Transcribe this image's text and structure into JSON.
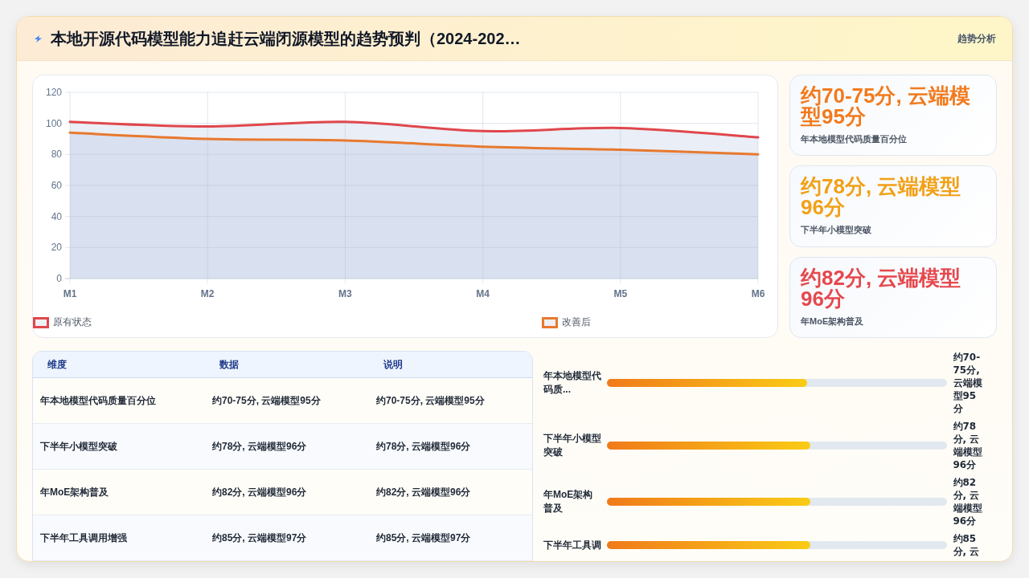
{
  "header": {
    "title": "本地开源代码模型能力追赶云端闭源模型的趋势预判（2024-202…",
    "tag": "趋势分析"
  },
  "chart": {
    "chart_data": {
      "type": "area",
      "categories": [
        "M1",
        "M2",
        "M3",
        "M4",
        "M5",
        "M6"
      ],
      "series": [
        {
          "name": "原有状态",
          "color": "#e0474c",
          "values": [
            101,
            98,
            101,
            95,
            97,
            91
          ]
        },
        {
          "name": "改善后",
          "color": "#e8792f",
          "values": [
            94,
            90,
            89,
            85,
            83,
            80
          ]
        }
      ],
      "ylim": [
        0,
        120
      ],
      "yticks": [
        0,
        20,
        40,
        60,
        80,
        100,
        120
      ],
      "grid": true,
      "legend": "bottom"
    }
  },
  "kpis": [
    {
      "value": "约70-75分, 云端模型95分",
      "label": "年本地模型代码质量百分位",
      "color": "#f27a1c"
    },
    {
      "value": "约78分, 云端模型96分",
      "label": "下半年小模型突破",
      "color": "#f2a016"
    },
    {
      "value": "约82分, 云端模型96分",
      "label": "年MoE架构普及",
      "color": "#e5484d"
    }
  ],
  "table": {
    "columns": [
      "维度",
      "数据",
      "说明"
    ],
    "rows": [
      [
        "年本地模型代码质量百分位",
        "约70-75分, 云端模型95分",
        "约70-75分, 云端模型95分"
      ],
      [
        "下半年小模型突破",
        "约78分, 云端模型96分",
        "约78分, 云端模型96分"
      ],
      [
        "年MoE架构普及",
        "约82分, 云端模型96分",
        "约82分, 云端模型96分"
      ],
      [
        "下半年工具调用增强",
        "约85分, 云端模型97分",
        "约85分, 云端模型97分"
      ]
    ]
  },
  "bars": [
    {
      "label": "年本地模型代码质...",
      "level": 0.59,
      "reading": "约70-75分, 云端模型95分"
    },
    {
      "label": "下半年小模型突破",
      "level": 0.6,
      "reading": "约78分, 云端模型96分"
    },
    {
      "label": "年MoE架构普及",
      "level": 0.6,
      "reading": "约82分, 云端模型96分"
    },
    {
      "label": "下半年工具调",
      "level": 0.6,
      "reading": "约85分, 云"
    }
  ]
}
